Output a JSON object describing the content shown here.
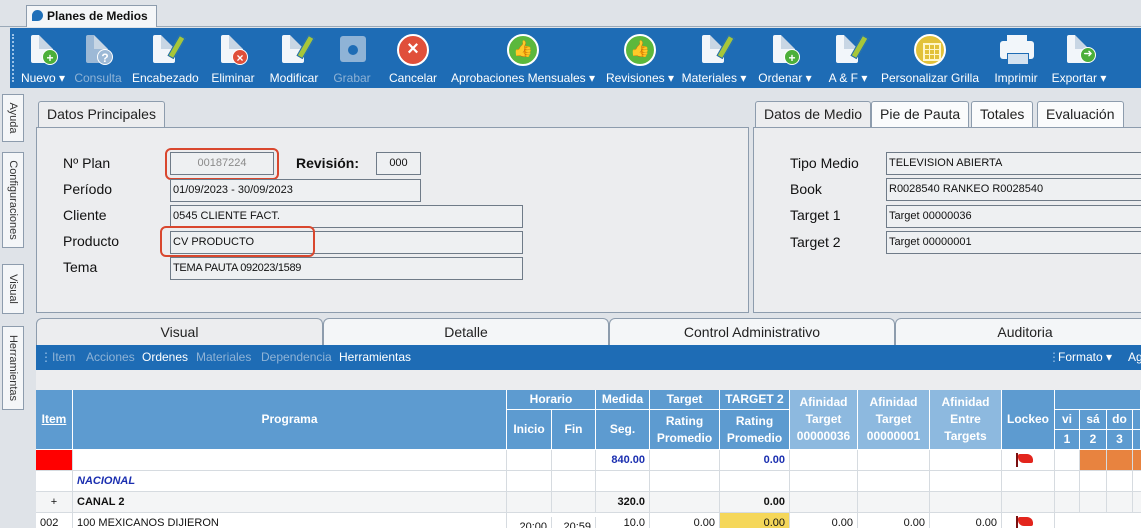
{
  "window": {
    "tab_title": "Planes de Medios"
  },
  "toolbar": {
    "nuevo": "Nuevo",
    "consulta": "Consulta",
    "encabezado": "Encabezado",
    "eliminar": "Eliminar",
    "modificar": "Modificar",
    "grabar": "Grabar",
    "cancelar": "Cancelar",
    "aprobaciones": "Aprobaciones Mensuales",
    "revisiones": "Revisiones",
    "materiales": "Materiales",
    "ordenar": "Ordenar",
    "ayf": "A & F",
    "personalizar": "Personalizar Grilla",
    "imprimir": "Imprimir",
    "exportar": "Exportar",
    "dropdown_glyph": "▾"
  },
  "side_tabs": {
    "ayuda": "Ayuda",
    "configuraciones": "Configuraciones",
    "visual": "Visual",
    "herramientas": "Herramientas"
  },
  "datos_principales": {
    "tab": "Datos Principales",
    "nplan_label": "Nº Plan",
    "nplan_value": "00187224",
    "revision_label": "Revisión:",
    "revision_value": "000",
    "periodo_label": "Período",
    "periodo_value": "01/09/2023 - 30/09/2023",
    "cliente_label": "Cliente",
    "cliente_value": "0545 CLIENTE FACT.",
    "producto_label": "Producto",
    "producto_value": "CV PRODUCTO",
    "tema_label": "Tema",
    "tema_value": "TEMA PAUTA 092023/1589"
  },
  "datos_medio": {
    "tabs": [
      "Datos de Medio",
      "Pie de Pauta",
      "Totales",
      "Evaluación"
    ],
    "tipo_medio_label": "Tipo Medio",
    "tipo_medio_value": "TELEVISION ABIERTA",
    "book_label": "Book",
    "book_value": "R0028540 RANKEO R0028540",
    "target1_label": "Target 1",
    "target1_value": "Target 00000036",
    "target2_label": "Target 2",
    "target2_value": "Target 00000001"
  },
  "main_tabs": [
    "Visual",
    "Detalle",
    "Control Administrativo",
    "Auditoria"
  ],
  "subtoolbar": {
    "item": "Item",
    "acciones": "Acciones",
    "ordenes": "Ordenes",
    "materiales": "Materiales",
    "dependencia": "Dependencia",
    "herramientas": "Herramientas",
    "formato": "Formato",
    "formato_arrow": "▾",
    "cut": "Agr"
  },
  "grid": {
    "headers": {
      "item": "Item",
      "programa": "Programa",
      "horario": "Horario",
      "inicio": "Inicio",
      "fin": "Fin",
      "medida": "Medida",
      "seg": "Seg.",
      "target": "Target",
      "rating_promedio": "Rating Promedio",
      "target2": "TARGET 2",
      "rating_promedio2": "Rating Promedio",
      "afinidad1": "Afinidad Target 00000036",
      "afinidad2": "Afinidad Target 00000001",
      "afinidad3": "Afinidad Entre Targets",
      "lockeo": "Lockeo",
      "days": [
        "vi",
        "sá",
        "do"
      ],
      "nums": [
        "1",
        "2",
        "3"
      ]
    },
    "summary": {
      "seg": "840.00",
      "rating2": "0.00"
    },
    "group": {
      "label": "NACIONAL"
    },
    "canal": {
      "expander": "+",
      "label": "CANAL 2",
      "seg": "320.0",
      "rating2": "0.00"
    },
    "rows": [
      {
        "item": "002",
        "programa": "100 MEXICANOS DIJIERON",
        "inicio": "20:00",
        "fin": "20:59",
        "seg": "10.0",
        "rating": "0.00",
        "rating2": "0.00",
        "afin1": "0.00",
        "afin2": "0.00",
        "afin3": "0.00"
      }
    ]
  },
  "colors": {
    "ribbon": "#1e6cb5",
    "header": "#5d9bd0",
    "highlight": "#d9472e",
    "summary_red": "#ff0000",
    "cell_orange": "#e8833f",
    "cell_yellow": "#f5d75a"
  }
}
